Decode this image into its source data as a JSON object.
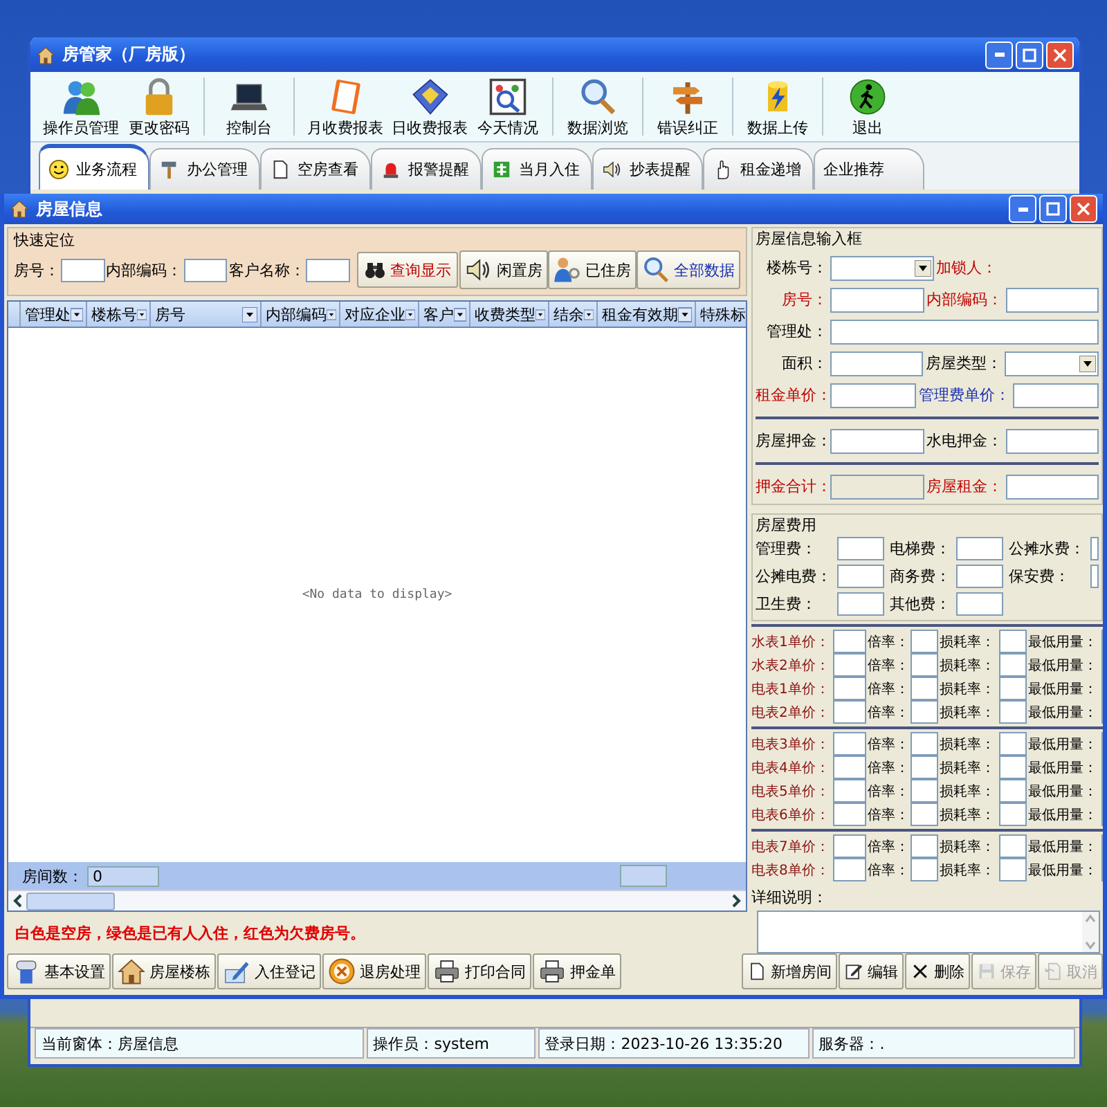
{
  "window": {
    "title": "房管家（厂房版）"
  },
  "toolbar": [
    [
      "操作员管理",
      "更改密码"
    ],
    [
      "控制台"
    ],
    [
      "月收费报表",
      "日收费报表",
      "今天情况"
    ],
    [
      "数据浏览"
    ],
    [
      "错误纠正"
    ],
    [
      "数据上传"
    ],
    [
      "退出"
    ]
  ],
  "tabs": [
    {
      "label": "业务流程",
      "selected": true
    },
    {
      "label": "办公管理",
      "selected": false
    },
    {
      "label": "空房查看",
      "selected": false
    },
    {
      "label": "报警提醒",
      "selected": false
    },
    {
      "label": "当月入住",
      "selected": false
    },
    {
      "label": "抄表提醒",
      "selected": false
    },
    {
      "label": "租金递增",
      "selected": false
    },
    {
      "label": "企业推荐",
      "selected": false
    }
  ],
  "house_window": {
    "title": "房屋信息",
    "quick_search": {
      "legend": "快速定位",
      "fields": [
        {
          "label": "房号："
        },
        {
          "label": "内部编码："
        },
        {
          "label": "客户名称："
        }
      ],
      "search_button": {
        "label": "查询显示",
        "color": "#c00000"
      },
      "filters": [
        {
          "label": "闲置房",
          "color": "#000000"
        },
        {
          "label": "已住房",
          "color": "#000000"
        },
        {
          "label": "全部数据",
          "color": "#1a2fb0"
        }
      ]
    },
    "grid": {
      "columns": [
        "管理处",
        "楼栋号",
        "房号",
        "内部编码",
        "对应企业",
        "客户",
        "收费类型",
        "结余",
        "租金有效期",
        "特殊标"
      ],
      "empty_text": "<No data to display>",
      "footer": {
        "label": "房间数：",
        "value": "0"
      }
    },
    "note": "白色是空房，绿色是已有人入住，红色为欠费房号。",
    "actions": [
      "基本设置",
      "房屋楼栋",
      "入住登记",
      "退房处理",
      "打印合同",
      "押金单"
    ],
    "record_actions": [
      {
        "label": "新增房间",
        "disabled": false
      },
      {
        "label": "编辑",
        "disabled": false
      },
      {
        "label": "删除",
        "disabled": false
      },
      {
        "label": "保存",
        "disabled": true
      },
      {
        "label": "取消",
        "disabled": true
      }
    ],
    "info": {
      "legend": "房屋信息输入框",
      "sections": [
        [
          [
            {
              "label": "楼栋号：",
              "color": "#000000",
              "kind": "select"
            },
            {
              "label": "加锁人：",
              "color": "#c00000",
              "kind": "label"
            }
          ],
          [
            {
              "label": "房号：",
              "color": "#c00000",
              "kind": "text"
            },
            {
              "label": "内部编码：",
              "color": "#c00000",
              "kind": "text"
            }
          ],
          [
            {
              "label": "管理处：",
              "color": "#000000",
              "kind": "text"
            }
          ],
          [
            {
              "label": "面积：",
              "color": "#000000",
              "kind": "text"
            },
            {
              "label": "房屋类型：",
              "color": "#000000",
              "kind": "select"
            }
          ],
          [
            {
              "label": "租金单价：",
              "color": "#c00000",
              "kind": "text"
            },
            {
              "label": "管理费单价：",
              "color": "#1a2fb0",
              "kind": "text"
            }
          ]
        ],
        [
          [
            {
              "label": "房屋押金：",
              "color": "#000000",
              "kind": "text"
            },
            {
              "label": "水电押金：",
              "color": "#000000",
              "kind": "text"
            }
          ]
        ],
        [
          [
            {
              "label": "押金合计：",
              "color": "#c00000",
              "kind": "readonly"
            },
            {
              "label": "房屋租金：",
              "color": "#c00000",
              "kind": "text"
            }
          ]
        ]
      ]
    },
    "fees": {
      "legend": "房屋费用",
      "items": [
        "管理费：",
        "电梯费：",
        "公摊水费：",
        "公摊电费：",
        "商务费：",
        "保安费：",
        "卫生费：",
        "其他费："
      ]
    },
    "meters": [
      [
        {
          "name": "水表1单价：",
          "rate": "倍率：",
          "loss": "损耗率：",
          "min": "最低用量："
        },
        {
          "name": "水表2单价：",
          "rate": "倍率：",
          "loss": "损耗率：",
          "min": "最低用量："
        },
        {
          "name": "电表1单价：",
          "rate": "倍率：",
          "loss": "损耗率：",
          "min": "最低用量："
        },
        {
          "name": "电表2单价：",
          "rate": "倍率：",
          "loss": "损耗率：",
          "min": "最低用量："
        }
      ],
      [
        {
          "name": "电表3单价：",
          "rate": "倍率：",
          "loss": "损耗率：",
          "min": "最低用量："
        },
        {
          "name": "电表4单价：",
          "rate": "倍率：",
          "loss": "损耗率：",
          "min": "最低用量："
        },
        {
          "name": "电表5单价：",
          "rate": "倍率：",
          "loss": "损耗率：",
          "min": "最低用量："
        },
        {
          "name": "电表6单价：",
          "rate": "倍率：",
          "loss": "损耗率：",
          "min": "最低用量："
        }
      ],
      [
        {
          "name": "电表7单价：",
          "rate": "倍率：",
          "loss": "损耗率：",
          "min": "最低用量："
        },
        {
          "name": "电表8单价：",
          "rate": "倍率：",
          "loss": "损耗率：",
          "min": "最低用量："
        }
      ]
    ],
    "details_label": "详细说明："
  },
  "status_bar": [
    "当前窗体：房屋信息",
    "操作员：system",
    "登录日期：2023-10-26 13:35:20",
    "服务器：."
  ]
}
